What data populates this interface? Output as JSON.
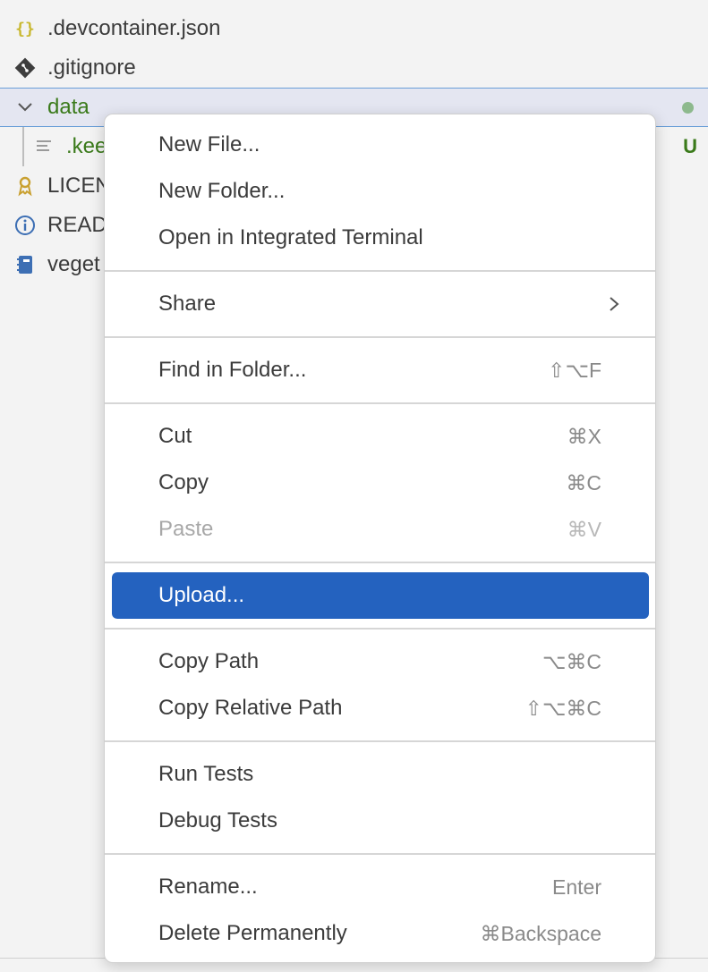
{
  "explorer": {
    "items": [
      {
        "label": ".devcontainer.json",
        "icon": "json-braces-icon"
      },
      {
        "label": ".gitignore",
        "icon": "git-icon"
      },
      {
        "label": "data",
        "icon": "chevron-down-icon",
        "git_status": "modified-dot"
      },
      {
        "label": ".kee",
        "icon": "text-file-icon",
        "git_status": "U"
      },
      {
        "label": "LICEN",
        "icon": "license-icon"
      },
      {
        "label": "READ",
        "icon": "info-icon"
      },
      {
        "label": "veget",
        "icon": "notebook-icon"
      }
    ]
  },
  "context_menu": {
    "groups": [
      [
        {
          "label": "New File...",
          "shortcut": ""
        },
        {
          "label": "New Folder...",
          "shortcut": ""
        },
        {
          "label": "Open in Integrated Terminal",
          "shortcut": ""
        }
      ],
      [
        {
          "label": "Share",
          "shortcut": "",
          "submenu": true
        }
      ],
      [
        {
          "label": "Find in Folder...",
          "shortcut": "⇧⌥F"
        }
      ],
      [
        {
          "label": "Cut",
          "shortcut": "⌘X"
        },
        {
          "label": "Copy",
          "shortcut": "⌘C"
        },
        {
          "label": "Paste",
          "shortcut": "⌘V",
          "disabled": true
        }
      ],
      [
        {
          "label": "Upload...",
          "shortcut": "",
          "active": true
        }
      ],
      [
        {
          "label": "Copy Path",
          "shortcut": "⌥⌘C"
        },
        {
          "label": "Copy Relative Path",
          "shortcut": "⇧⌥⌘C"
        }
      ],
      [
        {
          "label": "Run Tests",
          "shortcut": ""
        },
        {
          "label": "Debug Tests",
          "shortcut": ""
        }
      ],
      [
        {
          "label": "Rename...",
          "shortcut": "Enter"
        },
        {
          "label": "Delete Permanently",
          "shortcut": "⌘Backspace"
        }
      ]
    ]
  },
  "colors": {
    "accent": "#2462bf",
    "git_added": "#3a7a1a",
    "git_modified_dot": "#8db98d"
  }
}
